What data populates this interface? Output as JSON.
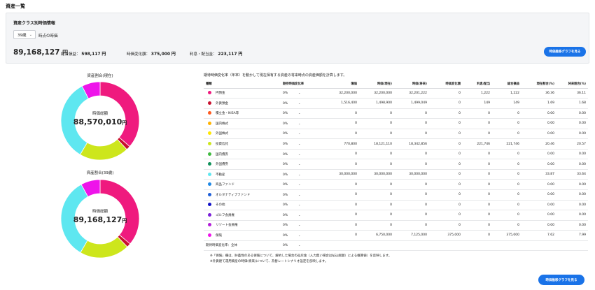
{
  "page_title": "資産一覧",
  "asset_panel": {
    "title": "資産クラス別時価情報",
    "age_select": "39歳",
    "at_time_label": "時点の時価",
    "total_value": "89,168,127",
    "total_unit": "円",
    "metrics": [
      {
        "label": "総合損益：",
        "value": "598,117",
        "unit": "円"
      },
      {
        "label": "時価変化額：",
        "value": "375,000",
        "unit": "円"
      },
      {
        "label": "利息・配当金：",
        "value": "223,117",
        "unit": "円"
      }
    ],
    "graph_button": "時価推移グラフを見る"
  },
  "donuts": [
    {
      "title": "資産割合(現在)",
      "center_label": "時価総額",
      "center_value": "88,570,010",
      "center_unit": "円",
      "segments": [
        {
          "name": "円預金",
          "value": 32200000,
          "color": "#ef1a7e"
        },
        {
          "name": "外貨預金",
          "value": 1498900,
          "color": "#c8102e"
        },
        {
          "name": "投資信託",
          "value": 18121110,
          "color": "#cde61c"
        },
        {
          "name": "不動産",
          "value": 30000000,
          "color": "#5ee7f0"
        },
        {
          "name": "保険",
          "value": 6750000,
          "color": "#ee14ea"
        }
      ]
    },
    {
      "title": "資産割合(39歳)",
      "center_label": "時価総額",
      "center_value": "89,168,127",
      "center_unit": "円",
      "segments": [
        {
          "name": "円預金",
          "value": 32201222,
          "color": "#ef1a7e"
        },
        {
          "name": "外貨預金",
          "value": 1499049,
          "color": "#c8102e"
        },
        {
          "name": "投資信託",
          "value": 18342856,
          "color": "#cde61c"
        },
        {
          "name": "不動産",
          "value": 30000000,
          "color": "#5ee7f0"
        },
        {
          "name": "保険",
          "value": 7125000,
          "color": "#ee14ea"
        }
      ]
    }
  ],
  "table": {
    "description": "期待時価変化率（年率）を動かして現在保有する資産の将来時点の資産価額を計算します。",
    "headers": [
      "種類",
      "期待時価変化率",
      "簿価",
      "時価(現在)",
      "時価(将来)",
      "時価変化額",
      "利息/配当",
      "総合損益",
      "現在割合(%)",
      "将来割合(%)"
    ],
    "rows": [
      {
        "name": "円預金",
        "color": "#ef1a7e",
        "rate": "0%",
        "cells": [
          "32,200,000",
          "32,200,000",
          "32,201,222",
          "0",
          "1,222",
          "1,222",
          "36.36",
          "36.11"
        ]
      },
      {
        "name": "外貨預金",
        "color": "#c8102e",
        "rate": "0%",
        "cells": [
          "1,516,400",
          "1,498,900",
          "1,499,049",
          "0",
          "149",
          "149",
          "1.69",
          "1.68"
        ]
      },
      {
        "name": "積立金・NISA等",
        "color": "#ff5a1f",
        "rate": "0%",
        "cells": [
          "0",
          "0",
          "0",
          "0",
          "0",
          "0",
          "0.00",
          "0.00"
        ]
      },
      {
        "name": "国内株式",
        "color": "#ffb300",
        "rate": "0%",
        "cells": [
          "0",
          "0",
          "0",
          "0",
          "0",
          "0",
          "0.00",
          "0.00"
        ]
      },
      {
        "name": "外国株式",
        "color": "#ffe600",
        "rate": "0%",
        "cells": [
          "0",
          "0",
          "0",
          "0",
          "0",
          "0",
          "0.00",
          "0.00"
        ]
      },
      {
        "name": "投資信託",
        "color": "#cde61c",
        "rate": "0%",
        "cells": [
          "770,800",
          "18,121,110",
          "18,342,856",
          "0",
          "221,746",
          "221,746",
          "20.46",
          "20.57"
        ]
      },
      {
        "name": "国内債券",
        "color": "#3fba3f",
        "rate": "0%",
        "cells": [
          "0",
          "0",
          "0",
          "0",
          "0",
          "0",
          "0.00",
          "0.00"
        ]
      },
      {
        "name": "外国債券",
        "color": "#10915a",
        "rate": "0%",
        "cells": [
          "0",
          "0",
          "0",
          "0",
          "0",
          "0",
          "0.00",
          "0.00"
        ]
      },
      {
        "name": "不動産",
        "color": "#5ee7f0",
        "rate": "0%",
        "cells": [
          "30,000,000",
          "30,000,000",
          "30,000,000",
          "0",
          "0",
          "0",
          "33.87",
          "33.64"
        ]
      },
      {
        "name": "商品ファンド",
        "color": "#1e88e5",
        "rate": "0%",
        "cells": [
          "0",
          "0",
          "0",
          "0",
          "0",
          "0",
          "0.00",
          "0.00"
        ]
      },
      {
        "name": "オルタナティブファンド",
        "color": "#1e5fd8",
        "rate": "0%",
        "cells": [
          "0",
          "0",
          "0",
          "0",
          "0",
          "0",
          "0.00",
          "0.00"
        ]
      },
      {
        "name": "その他",
        "color": "#1010c8",
        "rate": "0%",
        "cells": [
          "0",
          "0",
          "0",
          "0",
          "0",
          "0",
          "0.00",
          "0.00"
        ]
      },
      {
        "name": "ゴルフ会員権",
        "color": "#7a1fd8",
        "rate": "0%",
        "cells": [
          "0",
          "0",
          "0",
          "0",
          "0",
          "0",
          "0.00",
          "0.00"
        ]
      },
      {
        "name": "リゾート会員権",
        "color": "#b21fd8",
        "rate": "0%",
        "cells": [
          "0",
          "0",
          "0",
          "0",
          "0",
          "0",
          "0.00",
          "0.00"
        ]
      },
      {
        "name": "保険",
        "color": "#ee14ea",
        "rate": "0%",
        "cells": [
          "0",
          "6,750,000",
          "7,125,000",
          "375,000",
          "0",
          "375,000",
          "7.62",
          "7.99"
        ]
      }
    ],
    "overall_label": "期待時価変化率：全体",
    "overall_rate": "0%"
  },
  "notes": [
    "※「保険」欄は、貯蓄性のある保険について、解約した場合の返戻金（入力無い場合は払込総額）による概算値）を反映します。",
    "※外貨建て運用資産の時価(将来)について、為替レートシナリオ設定を反映します。"
  ],
  "bottom_button": "時価推移グラフを見る"
}
